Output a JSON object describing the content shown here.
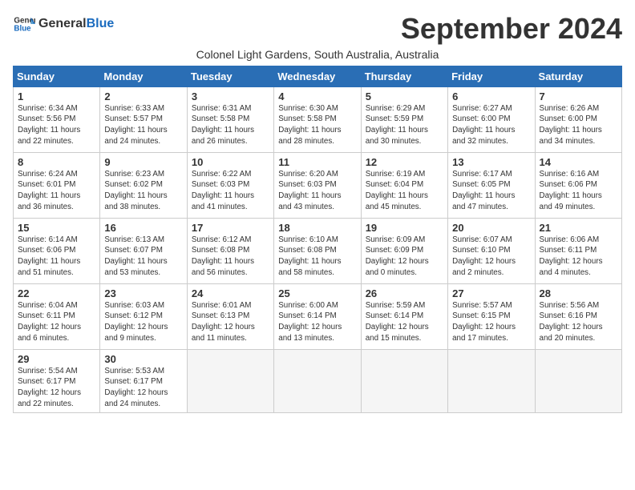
{
  "logo": {
    "general": "General",
    "blue": "Blue"
  },
  "title": "September 2024",
  "subtitle": "Colonel Light Gardens, South Australia, Australia",
  "headers": [
    "Sunday",
    "Monday",
    "Tuesday",
    "Wednesday",
    "Thursday",
    "Friday",
    "Saturday"
  ],
  "weeks": [
    [
      {
        "day": "1",
        "info": "Sunrise: 6:34 AM\nSunset: 5:56 PM\nDaylight: 11 hours\nand 22 minutes."
      },
      {
        "day": "2",
        "info": "Sunrise: 6:33 AM\nSunset: 5:57 PM\nDaylight: 11 hours\nand 24 minutes."
      },
      {
        "day": "3",
        "info": "Sunrise: 6:31 AM\nSunset: 5:58 PM\nDaylight: 11 hours\nand 26 minutes."
      },
      {
        "day": "4",
        "info": "Sunrise: 6:30 AM\nSunset: 5:58 PM\nDaylight: 11 hours\nand 28 minutes."
      },
      {
        "day": "5",
        "info": "Sunrise: 6:29 AM\nSunset: 5:59 PM\nDaylight: 11 hours\nand 30 minutes."
      },
      {
        "day": "6",
        "info": "Sunrise: 6:27 AM\nSunset: 6:00 PM\nDaylight: 11 hours\nand 32 minutes."
      },
      {
        "day": "7",
        "info": "Sunrise: 6:26 AM\nSunset: 6:00 PM\nDaylight: 11 hours\nand 34 minutes."
      }
    ],
    [
      {
        "day": "8",
        "info": "Sunrise: 6:24 AM\nSunset: 6:01 PM\nDaylight: 11 hours\nand 36 minutes."
      },
      {
        "day": "9",
        "info": "Sunrise: 6:23 AM\nSunset: 6:02 PM\nDaylight: 11 hours\nand 38 minutes."
      },
      {
        "day": "10",
        "info": "Sunrise: 6:22 AM\nSunset: 6:03 PM\nDaylight: 11 hours\nand 41 minutes."
      },
      {
        "day": "11",
        "info": "Sunrise: 6:20 AM\nSunset: 6:03 PM\nDaylight: 11 hours\nand 43 minutes."
      },
      {
        "day": "12",
        "info": "Sunrise: 6:19 AM\nSunset: 6:04 PM\nDaylight: 11 hours\nand 45 minutes."
      },
      {
        "day": "13",
        "info": "Sunrise: 6:17 AM\nSunset: 6:05 PM\nDaylight: 11 hours\nand 47 minutes."
      },
      {
        "day": "14",
        "info": "Sunrise: 6:16 AM\nSunset: 6:06 PM\nDaylight: 11 hours\nand 49 minutes."
      }
    ],
    [
      {
        "day": "15",
        "info": "Sunrise: 6:14 AM\nSunset: 6:06 PM\nDaylight: 11 hours\nand 51 minutes."
      },
      {
        "day": "16",
        "info": "Sunrise: 6:13 AM\nSunset: 6:07 PM\nDaylight: 11 hours\nand 53 minutes."
      },
      {
        "day": "17",
        "info": "Sunrise: 6:12 AM\nSunset: 6:08 PM\nDaylight: 11 hours\nand 56 minutes."
      },
      {
        "day": "18",
        "info": "Sunrise: 6:10 AM\nSunset: 6:08 PM\nDaylight: 11 hours\nand 58 minutes."
      },
      {
        "day": "19",
        "info": "Sunrise: 6:09 AM\nSunset: 6:09 PM\nDaylight: 12 hours\nand 0 minutes."
      },
      {
        "day": "20",
        "info": "Sunrise: 6:07 AM\nSunset: 6:10 PM\nDaylight: 12 hours\nand 2 minutes."
      },
      {
        "day": "21",
        "info": "Sunrise: 6:06 AM\nSunset: 6:11 PM\nDaylight: 12 hours\nand 4 minutes."
      }
    ],
    [
      {
        "day": "22",
        "info": "Sunrise: 6:04 AM\nSunset: 6:11 PM\nDaylight: 12 hours\nand 6 minutes."
      },
      {
        "day": "23",
        "info": "Sunrise: 6:03 AM\nSunset: 6:12 PM\nDaylight: 12 hours\nand 9 minutes."
      },
      {
        "day": "24",
        "info": "Sunrise: 6:01 AM\nSunset: 6:13 PM\nDaylight: 12 hours\nand 11 minutes."
      },
      {
        "day": "25",
        "info": "Sunrise: 6:00 AM\nSunset: 6:14 PM\nDaylight: 12 hours\nand 13 minutes."
      },
      {
        "day": "26",
        "info": "Sunrise: 5:59 AM\nSunset: 6:14 PM\nDaylight: 12 hours\nand 15 minutes."
      },
      {
        "day": "27",
        "info": "Sunrise: 5:57 AM\nSunset: 6:15 PM\nDaylight: 12 hours\nand 17 minutes."
      },
      {
        "day": "28",
        "info": "Sunrise: 5:56 AM\nSunset: 6:16 PM\nDaylight: 12 hours\nand 20 minutes."
      }
    ],
    [
      {
        "day": "29",
        "info": "Sunrise: 5:54 AM\nSunset: 6:17 PM\nDaylight: 12 hours\nand 22 minutes."
      },
      {
        "day": "30",
        "info": "Sunrise: 5:53 AM\nSunset: 6:17 PM\nDaylight: 12 hours\nand 24 minutes."
      },
      {
        "day": "",
        "info": ""
      },
      {
        "day": "",
        "info": ""
      },
      {
        "day": "",
        "info": ""
      },
      {
        "day": "",
        "info": ""
      },
      {
        "day": "",
        "info": ""
      }
    ]
  ]
}
